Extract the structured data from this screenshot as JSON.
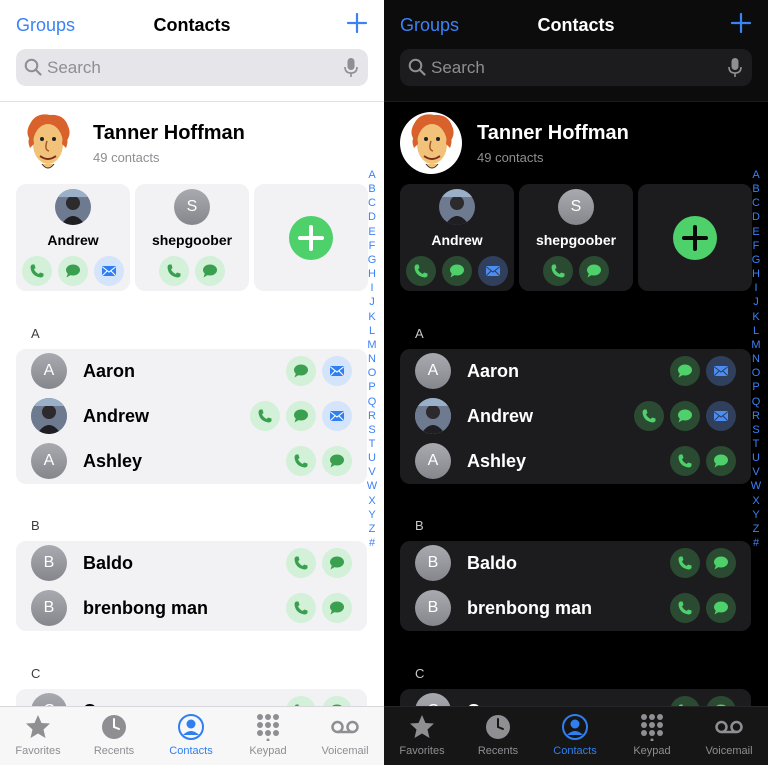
{
  "nav": {
    "groups_label": "Groups",
    "title": "Contacts"
  },
  "search": {
    "placeholder": "Search"
  },
  "my_card": {
    "name": "Tanner Hoffman",
    "subtitle": "49 contacts"
  },
  "favorites": [
    {
      "name": "Andrew",
      "actions": [
        "phone-icon",
        "message-icon",
        "mail-icon"
      ]
    },
    {
      "name": "shepgoober",
      "initial": "S",
      "actions": [
        "phone-icon",
        "message-icon"
      ]
    }
  ],
  "sections": [
    {
      "letter": "A",
      "contacts": [
        {
          "name": "Aaron",
          "initial": "A",
          "actions": [
            "message-icon",
            "mail-icon"
          ]
        },
        {
          "name": "Andrew",
          "photo": true,
          "actions": [
            "phone-icon",
            "message-icon",
            "mail-icon"
          ]
        },
        {
          "name": "Ashley",
          "initial": "A",
          "actions": [
            "phone-icon",
            "message-icon"
          ]
        }
      ]
    },
    {
      "letter": "B",
      "contacts": [
        {
          "name": "Baldo",
          "initial": "B",
          "actions": [
            "phone-icon",
            "message-icon"
          ]
        },
        {
          "name": "brenbong man",
          "initial": "B",
          "actions": [
            "phone-icon",
            "message-icon"
          ]
        }
      ]
    },
    {
      "letter": "C",
      "contacts": [
        {
          "name": "C",
          "initial": "C",
          "actions": [
            "phone-icon",
            "message-icon"
          ]
        }
      ]
    }
  ],
  "index_letters": [
    "A",
    "B",
    "C",
    "D",
    "E",
    "F",
    "G",
    "H",
    "I",
    "J",
    "K",
    "L",
    "M",
    "N",
    "O",
    "P",
    "Q",
    "R",
    "S",
    "T",
    "U",
    "V",
    "W",
    "X",
    "Y",
    "Z",
    "#"
  ],
  "tabs": [
    {
      "label": "Favorites",
      "icon": "star-icon"
    },
    {
      "label": "Recents",
      "icon": "clock-icon"
    },
    {
      "label": "Contacts",
      "icon": "person-circle-icon",
      "active": true
    },
    {
      "label": "Keypad",
      "icon": "keypad-icon"
    },
    {
      "label": "Voicemail",
      "icon": "voicemail-icon"
    }
  ],
  "colors": {
    "accent": "#3b82f6",
    "green": "#4ed06a",
    "phone_green": "#3aa04f",
    "mail_blue": "#2f7ff0"
  }
}
